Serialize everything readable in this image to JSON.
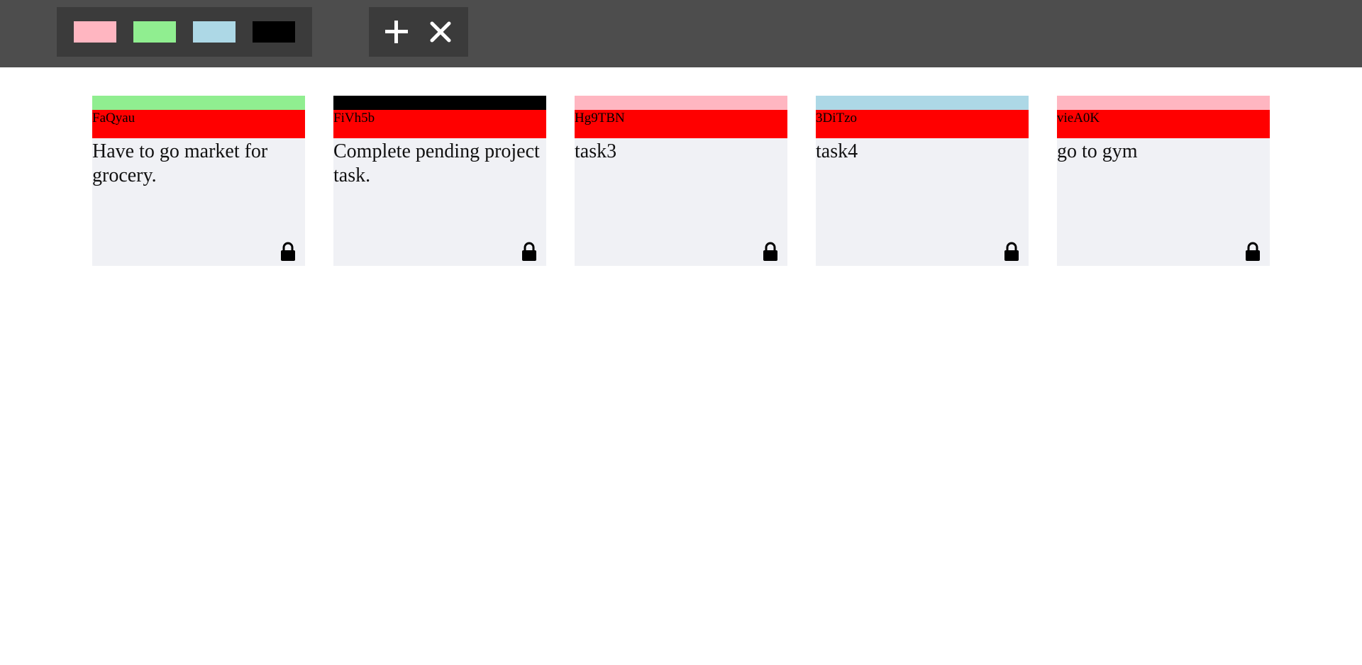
{
  "toolbar": {
    "palette": [
      {
        "name": "pink",
        "color": "#ffb6c1"
      },
      {
        "name": "green",
        "color": "#90ee90"
      },
      {
        "name": "blue",
        "color": "#add8e6"
      },
      {
        "name": "black",
        "color": "#000000"
      }
    ],
    "actions": [
      {
        "icon": "plus-icon"
      },
      {
        "icon": "close-icon"
      }
    ]
  },
  "colors": {
    "toolbar_bg": "#4d4d4d",
    "group_bg": "#3b3b3b",
    "note_header": "#ff0000",
    "note_body": "#f0f1f5"
  },
  "notes": [
    {
      "id": "FaQyau",
      "text": "Have to go market for grocery.",
      "color": "#90ee90",
      "icon": "lock-icon"
    },
    {
      "id": "FiVh5b",
      "text": "Complete pending project task.",
      "color": "#000000",
      "icon": "lock-icon"
    },
    {
      "id": "Hg9TBN",
      "text": "task3",
      "color": "#ffb6c1",
      "icon": "lock-icon"
    },
    {
      "id": "3DiTzo",
      "text": "task4",
      "color": "#add8e6",
      "icon": "lock-icon"
    },
    {
      "id": "vieA0K",
      "text": "go to gym",
      "color": "#ffb6c1",
      "icon": "lock-icon"
    }
  ]
}
